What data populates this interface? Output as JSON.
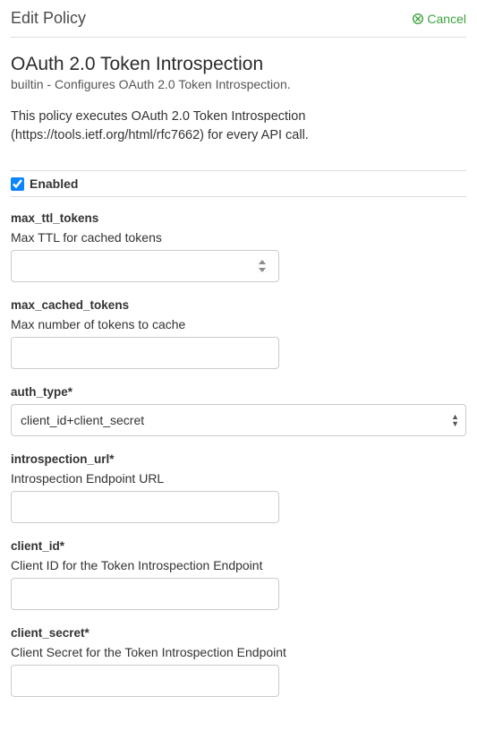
{
  "header": {
    "title": "Edit Policy",
    "cancel_label": "Cancel"
  },
  "policy": {
    "title": "OAuth 2.0 Token Introspection",
    "type": "builtin",
    "sep": "-",
    "summary": "Configures OAuth 2.0 Token Introspection.",
    "description": "This policy executes OAuth 2.0 Token Introspection (https://tools.ietf.org/html/rfc7662) for every API call."
  },
  "enabled": {
    "label": "Enabled",
    "checked": true
  },
  "fields": {
    "max_ttl_tokens": {
      "name": "max_ttl_tokens",
      "help": "Max TTL for cached tokens",
      "value": ""
    },
    "max_cached_tokens": {
      "name": "max_cached_tokens",
      "help": "Max number of tokens to cache",
      "value": ""
    },
    "auth_type": {
      "name": "auth_type*",
      "selected": "client_id+client_secret"
    },
    "introspection_url": {
      "name": "introspection_url*",
      "help": "Introspection Endpoint URL",
      "value": ""
    },
    "client_id": {
      "name": "client_id*",
      "help": "Client ID for the Token Introspection Endpoint",
      "value": ""
    },
    "client_secret": {
      "name": "client_secret*",
      "help": "Client Secret for the Token Introspection Endpoint",
      "value": ""
    }
  }
}
